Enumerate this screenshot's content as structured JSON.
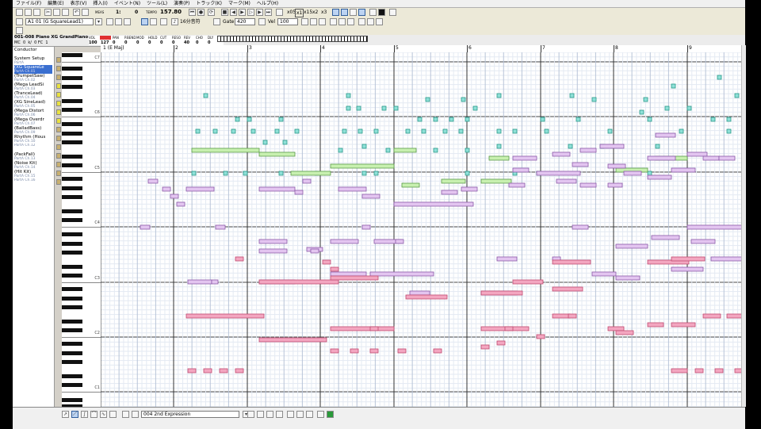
{
  "menu": [
    "ファイル(F)",
    "編集(E)",
    "表示(V)",
    "挿入(I)",
    "イベント(N)",
    "ツール(L)",
    "演奏(P)",
    "トラック(K)",
    "マーク(M)",
    "ヘルプ(H)"
  ],
  "toolbar": {
    "meas_label": "MEAS",
    "measure": "1:",
    "beat": "0",
    "tempo_label": "TEMPO",
    "tempo": "157.80",
    "zoom_buttons": [
      "x05",
      "x1",
      "x15",
      "x2",
      "x3"
    ]
  },
  "toolbar2": {
    "track_select": "A1  01 (G SquareLead1)",
    "note_length": "16分音符",
    "gate_label": "Gate",
    "gate": "420",
    "vel_label": "Vel",
    "vel": "100"
  },
  "status": {
    "instrument": "001-008 Piano XG GrandPiano",
    "row2": "MC  0  k/  0 FC  1",
    "meter_labels": [
      "VOL",
      "EXP",
      "PAN",
      "P.BEND",
      "MOD",
      "HOLD",
      "CUT",
      "RESO",
      "REV",
      "CHO",
      "DLY"
    ],
    "meter_values": [
      "100",
      "127",
      "0",
      "0",
      "0",
      "0",
      "0",
      "0",
      "40",
      "0",
      "0"
    ]
  },
  "tracks": [
    {
      "name": "Conductor",
      "sub": ""
    },
    {
      "name": "System Setup",
      "sub": "PartA"
    },
    {
      "name": "(XG SquareLe",
      "sub": "PartA  Ch.01"
    },
    {
      "name": "(TrumpetSaw)",
      "sub": "PartA  Ch.02"
    },
    {
      "name": "(Mega LeadSi",
      "sub": "PartA  Ch.03"
    },
    {
      "name": "(TranceLead)",
      "sub": "PartA  Ch.04"
    },
    {
      "name": "(XG SineLead)",
      "sub": "PartA  Ch.05"
    },
    {
      "name": "(Mega Distort",
      "sub": "PartA  Ch.06"
    },
    {
      "name": "(Mega Overdr",
      "sub": "PartA  Ch.07"
    },
    {
      "name": "(BalladBass)",
      "sub": "PartA  Ch.09"
    },
    {
      "name": "Rhythm (Hous",
      "sub": "PartA  Ch.10"
    },
    {
      "name": "",
      "sub": "PartA  Ch.12"
    },
    {
      "name": "(PackFall)",
      "sub": "PartA  Ch.13"
    },
    {
      "name": "(Noise Kit)",
      "sub": "PartA  Ch.14"
    },
    {
      "name": "(Hit Kit)",
      "sub": "PartA  Ch.15"
    },
    {
      "name": "",
      "sub": "PartA  Ch.16"
    }
  ],
  "ruler": {
    "start_label": "1 (E Maj)",
    "measures": [
      "2",
      "3",
      "4",
      "5",
      "6",
      "7",
      "8",
      "9"
    ]
  },
  "octaves": [
    "C7",
    "C6",
    "C5",
    "C4",
    "C3",
    "C2",
    "C1"
  ],
  "bottom": {
    "controller": "004 2nd Expression"
  },
  "colors": {
    "cyan_note": "#8fe0d8",
    "green_note": "#c8f0b0",
    "purple_note": "#e3c5f0",
    "pink_note": "#f3a6c0",
    "lavender_note": "#d6c2f2",
    "grid_line": "#d8e2ef"
  }
}
